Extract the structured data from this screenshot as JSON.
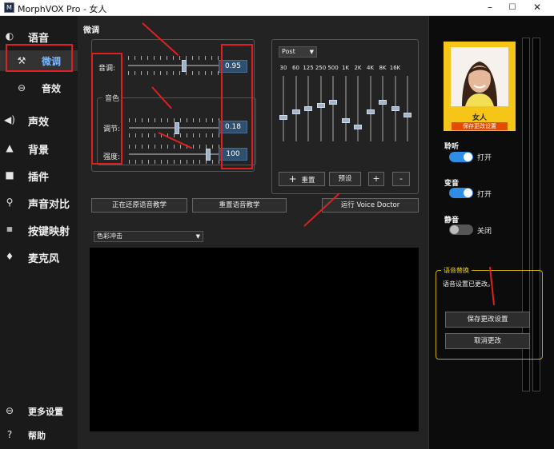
{
  "window": {
    "app_icon": "M",
    "title": "MorphVOX Pro - 女人",
    "controls": [
      "–",
      "☐",
      "✕"
    ]
  },
  "sidebar": {
    "items": [
      {
        "label": "语音",
        "icon": "voice-icon"
      },
      {
        "label": "微调",
        "icon": "tools-icon"
      },
      {
        "label": "音效",
        "icon": "sound-effect-icon"
      },
      {
        "label": "声效",
        "icon": "speaker-icon"
      },
      {
        "label": "背景",
        "icon": "background-icon"
      },
      {
        "label": "插件",
        "icon": "plugin-icon"
      },
      {
        "label": "声音对比",
        "icon": "compare-icon"
      },
      {
        "label": "按键映射",
        "icon": "keymap-icon"
      },
      {
        "label": "麦克风",
        "icon": "microphone-icon"
      }
    ],
    "bottom": [
      {
        "label": "更多设置",
        "icon": "more-settings-icon"
      },
      {
        "label": "帮助",
        "icon": "help-icon"
      }
    ]
  },
  "tweak": {
    "title": "微调",
    "pitch": {
      "label": "音调:",
      "value": "0.95",
      "level": 0.6
    },
    "timbre": {
      "group_title": "音色",
      "adjust": {
        "label": "调节:",
        "value": "0.18",
        "level": 0.52
      },
      "strength": {
        "label": "强度:",
        "value": "100",
        "level": 0.85
      }
    },
    "restore_button": "正在还原语音教学",
    "retrain_button": "重置语音教学"
  },
  "eq": {
    "mode": "Post",
    "freqs": [
      "30",
      "60",
      "125",
      "250",
      "500",
      "1K",
      "2K",
      "4K",
      "8K",
      "16K"
    ],
    "levels": [
      0.35,
      0.45,
      0.5,
      0.55,
      0.6,
      0.3,
      0.2,
      0.45,
      0.6,
      0.5,
      0.4
    ],
    "buttons": {
      "reset_icon": "+",
      "reset": "重置",
      "preset": "预设",
      "add": "+",
      "remove": "-"
    },
    "voice_doctor": "运行 Voice Doctor"
  },
  "visualizer": {
    "mode": "色彩冲击"
  },
  "profile": {
    "name": "女人",
    "tag": "保存更改设置"
  },
  "toggles": [
    {
      "label": "聆听",
      "state": "打开",
      "on": true
    },
    {
      "label": "变音",
      "state": "打开",
      "on": true
    },
    {
      "label": "静音",
      "state": "关闭",
      "on": false
    }
  ],
  "voice_swap": {
    "title": "语音替换",
    "message": "语音设置已更改。",
    "save": "保存更改设置",
    "cancel": "取消更改"
  },
  "colors": {
    "accent": "#2f8de4",
    "annotation": "#e02020",
    "panel_border": "#f5c518"
  }
}
